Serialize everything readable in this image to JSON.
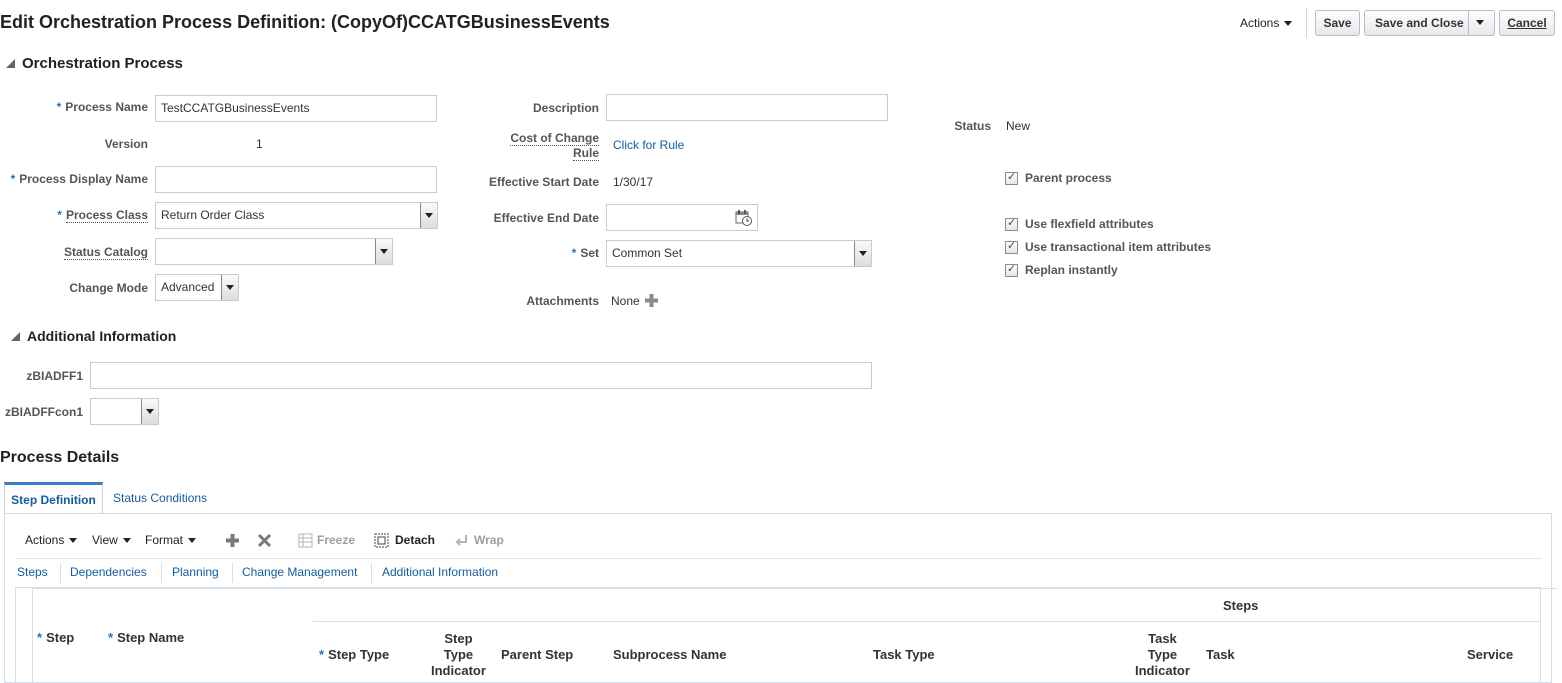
{
  "page_title": "Edit Orchestration Process Definition: (CopyOf)CCATGBusinessEvents",
  "header": {
    "actions_label": "Actions",
    "save_label": "Save",
    "save_close_label": "Save and Close",
    "cancel_label": "Cancel"
  },
  "orchestration": {
    "section_title": "Orchestration Process",
    "process_name_label": "Process Name",
    "process_name_value": "TestCCATGBusinessEvents",
    "version_label": "Version",
    "version_value": "1",
    "display_name_label": "Process Display Name",
    "display_name_value": "",
    "process_class_label": "Process Class",
    "process_class_value": "Return Order Class",
    "status_catalog_label": "Status Catalog",
    "status_catalog_value": "",
    "change_mode_label": "Change Mode",
    "change_mode_value": "Advanced",
    "description_label": "Description",
    "description_value": "",
    "cost_rule_label_1": "Cost of Change",
    "cost_rule_label_2": "Rule",
    "cost_rule_link": "Click for Rule",
    "eff_start_label": "Effective Start Date",
    "eff_start_value": "1/30/17",
    "eff_end_label": "Effective End Date",
    "eff_end_value": "",
    "set_label": "Set",
    "set_value": "Common Set",
    "attachments_label": "Attachments",
    "attachments_value": "None",
    "status_label": "Status",
    "status_value": "New",
    "parent_process_label": "Parent process",
    "flexfield_label": "Use flexfield attributes",
    "transactional_label": "Use transactional item attributes",
    "replan_label": "Replan instantly"
  },
  "additional": {
    "section_title": "Additional Information",
    "field1_label": "zBIADFF1",
    "field1_value": "",
    "field2_label": "zBIADFFcon1",
    "field2_value": ""
  },
  "details": {
    "section_title": "Process Details",
    "tabs": [
      "Step Definition",
      "Status Conditions"
    ],
    "toolbar": {
      "actions": "Actions",
      "view": "View",
      "format": "Format",
      "freeze": "Freeze",
      "detach": "Detach",
      "wrap": "Wrap"
    },
    "subtabs": [
      "Steps",
      "Dependencies",
      "Planning",
      "Change Management",
      "Additional Information"
    ],
    "table": {
      "group_header": "Steps",
      "step": "Step",
      "step_name": "Step Name",
      "step_type": "Step Type",
      "step_type_indicator": [
        "Step",
        "Type",
        "Indicator"
      ],
      "parent_step": "Parent Step",
      "subprocess_name": "Subprocess Name",
      "task_type": "Task Type",
      "task_type_indicator": [
        "Task",
        "Type",
        "Indicator"
      ],
      "task": "Task",
      "service": "Service"
    }
  }
}
